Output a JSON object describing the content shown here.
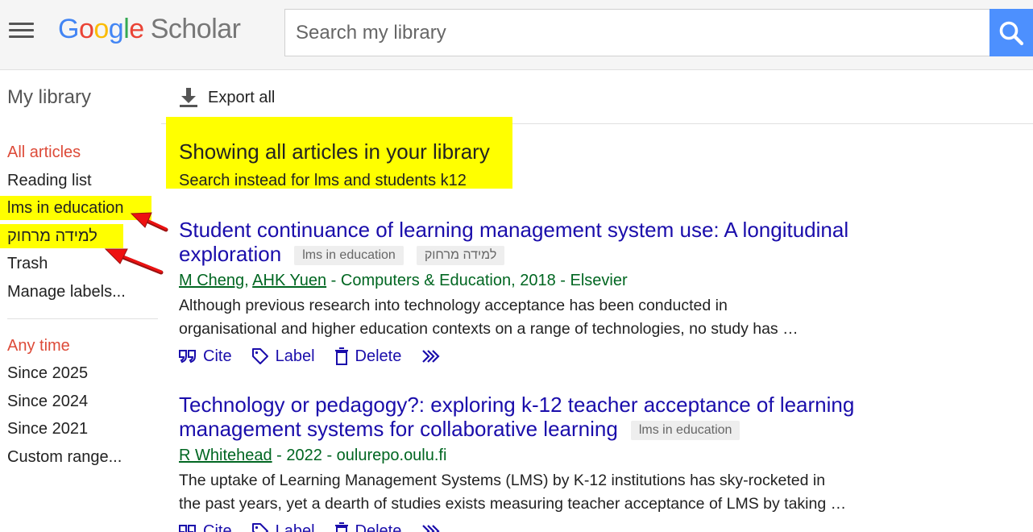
{
  "header": {
    "logo_letters": [
      "G",
      "o",
      "o",
      "g",
      "l",
      "e"
    ],
    "logo_product": "Scholar",
    "search_placeholder": "Search my library"
  },
  "sidebar": {
    "title": "My library",
    "labels": [
      {
        "label": "All articles",
        "active": true
      },
      {
        "label": "Reading list"
      },
      {
        "label": "lms in education",
        "highlighted": true
      },
      {
        "label": "למידה מרחוק",
        "highlighted": true
      },
      {
        "label": "Trash"
      },
      {
        "label": "Manage labels..."
      }
    ],
    "time_filters": [
      {
        "label": "Any time",
        "active": true
      },
      {
        "label": "Since 2025"
      },
      {
        "label": "Since 2024"
      },
      {
        "label": "Since 2021"
      },
      {
        "label": "Custom range..."
      }
    ]
  },
  "toolbar": {
    "export_label": "Export all"
  },
  "notice": {
    "title": "Showing all articles in your library",
    "subtitle": "Search instead for lms and students k12"
  },
  "results": [
    {
      "title_line1": "Student continuance of learning management system use: A longitudinal",
      "title_line2": "exploration",
      "tags": [
        "lms in education",
        "למידה מרחוק"
      ],
      "authors": [
        "M Cheng",
        "AHK Yuen"
      ],
      "source": " - Computers & Education, 2018 - Elsevier",
      "snippet_line1": "Although previous research into technology acceptance has been conducted in",
      "snippet_line2": "organisational and higher education contexts on a range of technologies, no study has …",
      "actions": {
        "cite": "Cite",
        "label": "Label",
        "delete": "Delete"
      }
    },
    {
      "title_line1": "Technology or pedagogy?: exploring k-12 teacher acceptance of learning",
      "title_line2": "management systems for collaborative learning",
      "tags": [
        "lms in education"
      ],
      "authors": [
        "R Whitehead"
      ],
      "source": " - 2022 - oulurepo.oulu.fi",
      "snippet_line1": "The uptake of Learning Management Systems (LMS) by K-12 institutions has sky-rocketed in",
      "snippet_line2": "the past years, yet a dearth of studies exists measuring teacher acceptance of LMS by taking …",
      "actions": {
        "cite": "Cite",
        "label": "Label",
        "delete": "Delete"
      }
    }
  ],
  "colors": {
    "link": "#1a0dab",
    "meta_green": "#006621",
    "active_red": "#dd4b39",
    "highlight": "#ffff00",
    "annotation_arrow": "#ee1111"
  }
}
